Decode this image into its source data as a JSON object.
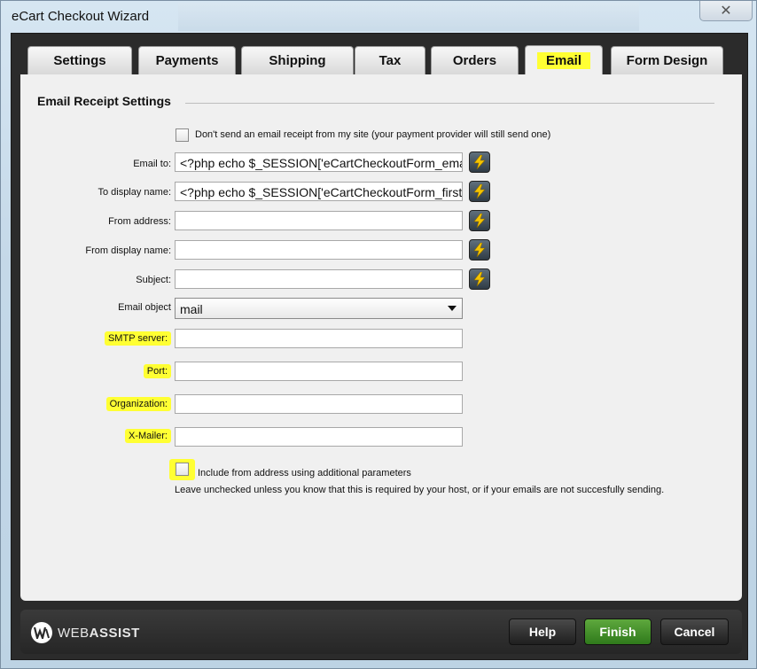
{
  "window": {
    "title": "eCart Checkout Wizard",
    "close_glyph": "✕"
  },
  "tabs": [
    {
      "label": "Settings"
    },
    {
      "label": "Payments"
    },
    {
      "label": "Shipping"
    },
    {
      "label": "Tax"
    },
    {
      "label": "Orders"
    },
    {
      "label": "Email",
      "active": true
    },
    {
      "label": "Form Design"
    }
  ],
  "section": {
    "title": "Email Receipt Settings"
  },
  "dont_send": {
    "label": "Don't send an email receipt from my site (your payment provider will still send one)",
    "checked": false
  },
  "fields": {
    "email_to": {
      "label": "Email to:",
      "value": "<?php echo $_SESSION['eCartCheckoutForm_email']; ?>"
    },
    "to_display_name": {
      "label": "To display name:",
      "value": "<?php echo $_SESSION['eCartCheckoutForm_firstname']; ?>"
    },
    "from_address": {
      "label": "From address:",
      "value": ""
    },
    "from_display_name": {
      "label": "From display name:",
      "value": ""
    },
    "subject": {
      "label": "Subject:",
      "value": ""
    },
    "email_object": {
      "label": "Email object",
      "value": "mail"
    },
    "smtp_server": {
      "label": "SMTP server:",
      "value": ""
    },
    "port": {
      "label": "Port:",
      "value": ""
    },
    "organization": {
      "label": "Organization:",
      "value": ""
    },
    "x_mailer": {
      "label": "X-Mailer:",
      "value": ""
    }
  },
  "include_from": {
    "label": "Include from address using additional parameters",
    "help": "Leave unchecked unless you know that this is required by your host, or if your emails are not succesfully sending.",
    "checked": false
  },
  "footer": {
    "logo_prefix": "WEB",
    "logo_suffix": "ASSIST",
    "help_label": "Help",
    "finish_label": "Finish",
    "cancel_label": "Cancel"
  },
  "colors": {
    "highlight": "#ffff33",
    "finish": "#3d8a26",
    "panel": "#f0f0f0",
    "chrome": "#2b2b2b"
  },
  "icons": {
    "lightning": "lightning-icon",
    "dropdown": "chevron-down-icon",
    "close": "close-icon"
  }
}
